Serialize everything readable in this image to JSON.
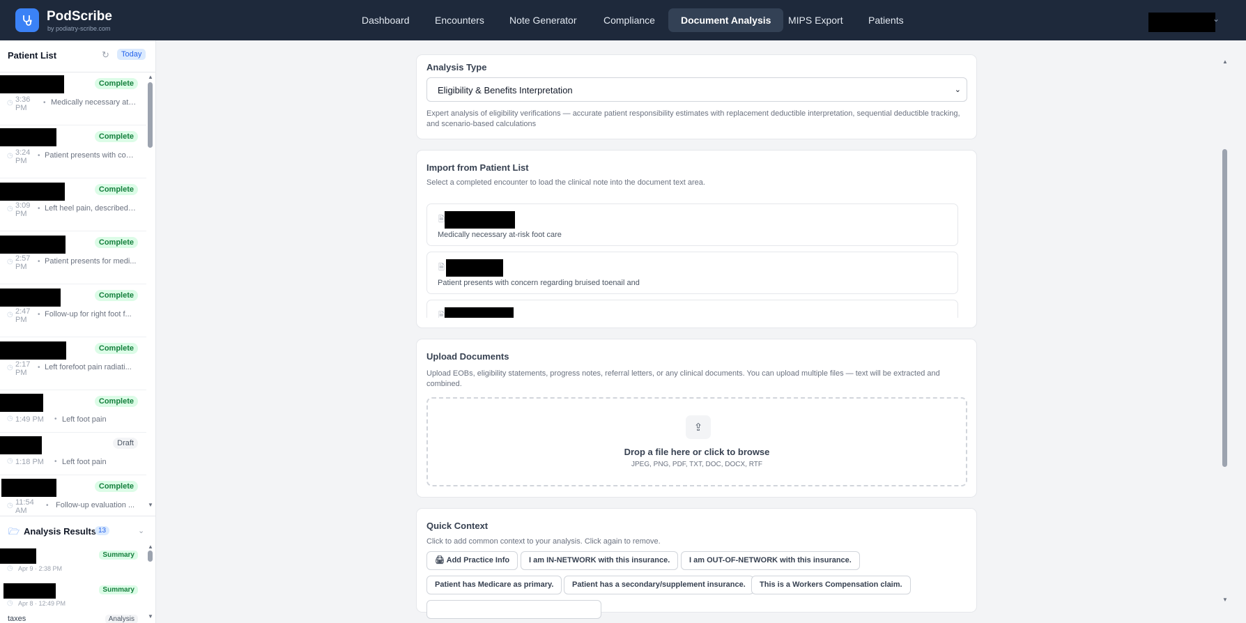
{
  "brand": {
    "name": "PodScribe",
    "subtitle": "by podiatry-scribe.com"
  },
  "nav": {
    "items": [
      "Dashboard",
      "Encounters",
      "Note Generator",
      "Compliance",
      "Document Analysis",
      "MIPS Export",
      "Patients"
    ],
    "active": "Document Analysis"
  },
  "sidebar": {
    "title": "Patient List",
    "today_label": "Today",
    "patients": [
      {
        "status": "Complete",
        "time": "3:36 PM",
        "desc": "Medically necessary at-..."
      },
      {
        "status": "Complete",
        "time": "3:24 PM",
        "desc": "Patient presents with con..."
      },
      {
        "status": "Complete",
        "time": "3:09 PM",
        "desc": "Left heel pain, described ..."
      },
      {
        "status": "Complete",
        "time": "2:57 PM",
        "desc": "Patient presents for medi..."
      },
      {
        "status": "Complete",
        "time": "2:47 PM",
        "desc": "Follow-up for right foot f..."
      },
      {
        "status": "Complete",
        "time": "2:17 PM",
        "desc": "Left forefoot pain radiati..."
      },
      {
        "status": "Complete",
        "time": "1:49 PM",
        "desc": "Left foot pain"
      },
      {
        "status": "Draft",
        "time": "1:18 PM",
        "desc": "Left foot pain"
      },
      {
        "status": "Complete",
        "time": "11:54 AM",
        "desc": "Follow-up evaluation ..."
      }
    ],
    "analysis_results": {
      "title": "Analysis Results",
      "count": "13",
      "items": [
        {
          "badge": "Summary",
          "date": "Apr 9 · 2:38 PM"
        },
        {
          "badge": "Summary",
          "date": "Apr 8 · 12:49 PM"
        },
        {
          "label": "taxes",
          "badge": "Analysis",
          "date": ""
        }
      ]
    }
  },
  "analysis_type": {
    "title": "Analysis Type",
    "selected": "Eligibility & Benefits Interpretation",
    "description": "Expert analysis of eligibility verifications — accurate patient responsibility estimates with replacement deductible interpretation, sequential deductible tracking, and scenario-based calculations"
  },
  "import": {
    "title": "Import from Patient List",
    "description": "Select a completed encounter to load the clinical note into the document text area.",
    "items": [
      {
        "text": "Medically necessary at-risk foot care"
      },
      {
        "text": "Patient presents with concern regarding bruised toenail and"
      },
      {
        "text": ""
      }
    ]
  },
  "upload": {
    "title": "Upload Documents",
    "description": "Upload EOBs, eligibility statements, progress notes, referral letters, or any clinical documents. You can upload multiple files — text will be extracted and combined.",
    "drop_title": "Drop a file here or click to browse",
    "drop_types": "JPEG, PNG, PDF, TXT, DOC, DOCX, RTF"
  },
  "quick_context": {
    "title": "Quick Context",
    "description": "Click to add common context to your analysis. Click again to remove.",
    "chips": [
      "Add Practice Info",
      "I am IN-NETWORK with this insurance.",
      "I am OUT-OF-NETWORK with this insurance.",
      "Patient has Medicare as primary.",
      "Patient has a secondary/supplement insurance.",
      "This is a Workers Compensation claim."
    ]
  },
  "colors": {
    "nav_bg": "#1e293b",
    "accent": "#3b82f6",
    "complete": "#15803d"
  }
}
